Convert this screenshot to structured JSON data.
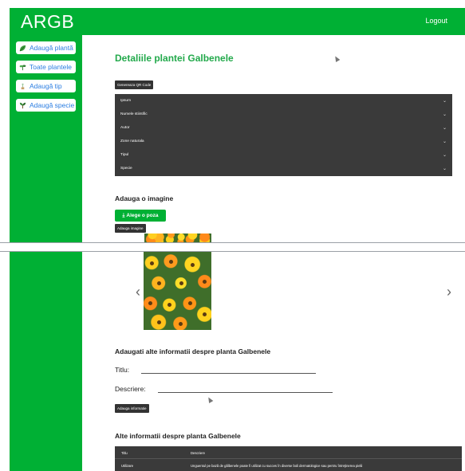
{
  "brand": "ARGB",
  "header": {
    "logout_label": "Logout"
  },
  "sidebar": {
    "items": [
      {
        "label": "Adaugă plantă",
        "icon": "leaf-icon"
      },
      {
        "label": "Toate plantele",
        "icon": "seedling-icon"
      },
      {
        "label": "Adaugă tip",
        "icon": "plant-icon"
      },
      {
        "label": "Adaugă specie",
        "icon": "sprout-icon"
      }
    ]
  },
  "main": {
    "title": "Detaliile plantei Galbenele",
    "qr_button": "Genereaza QR Code",
    "accordion": [
      "Ipsum",
      "Numele stiintific",
      "Autor",
      "Zone naturala",
      "Tipul",
      "Specie"
    ],
    "add_image_title": "Adauga o imagine",
    "choose_photo_button": "Alege o poza",
    "add_image_button": "Adauga imagine",
    "carousel": {
      "prev": "‹",
      "next": "›"
    },
    "add_info_title": "Adaugati alte informatii despre planta Galbenele",
    "form": {
      "title_label": "Titlu:",
      "title_value": "",
      "description_label": "Descriere:",
      "description_value": "",
      "submit_label": "Adauga informatie"
    },
    "info_title": "Alte informatii despre planta Galbenele",
    "table": {
      "headers": [
        "Titlu",
        "Descriere"
      ],
      "rows": [
        [
          "Utilizare",
          "Unguentul pe bază de gălbenele poate fi utilizat cu succes în diverse boli dermatologice sau pentru întreţinerea pielii"
        ]
      ]
    }
  },
  "colors": {
    "brand_green": "#00b034",
    "title_green": "#22a94b",
    "dark_panel": "#3a3a3a",
    "link_blue": "#2a7de1"
  }
}
